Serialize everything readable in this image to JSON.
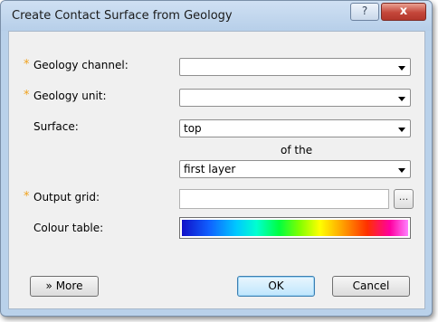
{
  "window": {
    "title": "Create Contact Surface from Geology",
    "help_glyph": "?",
    "close_glyph": "x"
  },
  "form": {
    "required_marker": "*",
    "geology_channel": {
      "label": "Geology channel:",
      "value": ""
    },
    "geology_unit": {
      "label": "Geology unit:",
      "value": ""
    },
    "surface": {
      "label": "Surface:",
      "value": "top"
    },
    "of_the": "of the",
    "layer": {
      "value": "first layer"
    },
    "output_grid": {
      "label": "Output grid:",
      "value": "",
      "browse": "..."
    },
    "colour_table": {
      "label": "Colour table:"
    }
  },
  "buttons": {
    "more": "More",
    "more_glyph": "»",
    "ok": "OK",
    "cancel": "Cancel"
  },
  "colors": {
    "required_marker": "#f0a21d",
    "window_frame": "#b9d1ea",
    "close_button": "#c4463a"
  }
}
